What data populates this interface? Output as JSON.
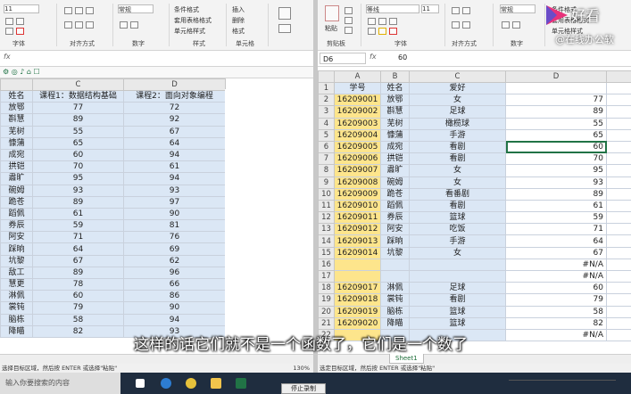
{
  "left": {
    "ribbon_groups": [
      "字体",
      "对齐方式",
      "数字",
      "样式",
      "单元格"
    ],
    "style_items": [
      "条件格式",
      "套用表格格式",
      "单元格样式"
    ],
    "cell_items": [
      "插入",
      "删除",
      "格式"
    ],
    "num_format": "常规",
    "font_size": "11",
    "columns": [
      "C",
      "D"
    ],
    "header_row": {
      "name": "姓名",
      "c": "课程1：数据结构基础",
      "d": "课程2：面向对象编程"
    },
    "rows": [
      [
        "放鄂",
        "77",
        "72"
      ],
      [
        "斟慧",
        "89",
        "92"
      ],
      [
        "芜树",
        "55",
        "67"
      ],
      [
        "慷蒲",
        "65",
        "64"
      ],
      [
        "成宛",
        "60",
        "94"
      ],
      [
        "拱铠",
        "70",
        "61"
      ],
      [
        "肅旷",
        "95",
        "94"
      ],
      [
        "碗姆",
        "93",
        "93"
      ],
      [
        "跪苍",
        "89",
        "97"
      ],
      [
        "蹈佩",
        "61",
        "90"
      ],
      [
        "券辰",
        "59",
        "81"
      ],
      [
        "阿安",
        "71",
        "76"
      ],
      [
        "踩晌",
        "64",
        "69"
      ],
      [
        "坑黎",
        "67",
        "62"
      ],
      [
        "敌工",
        "89",
        "96"
      ],
      [
        "慧更",
        "78",
        "66"
      ],
      [
        "淋佩",
        "60",
        "86"
      ],
      [
        "裳钝",
        "79",
        "90"
      ],
      [
        "脑栋",
        "58",
        "94"
      ],
      [
        "降瞄",
        "82",
        "93"
      ]
    ],
    "zoom": "130%",
    "status": "选择目标区域，然后按 ENTER 或选择\"粘贴\""
  },
  "right": {
    "ribbon_groups": [
      "剪贴板",
      "字体",
      "对齐方式",
      "数字"
    ],
    "paste_label": "粘贴",
    "font_name": "等线",
    "font_size": "11",
    "num_format": "常规",
    "style_items": [
      "条件格式",
      "套用表格格式",
      "单元格样式"
    ],
    "name_box": "D6",
    "formula_value": "60",
    "columns": [
      "A",
      "B",
      "C",
      "D"
    ],
    "header_row": {
      "a": "学号",
      "b": "姓名",
      "c": "爱好",
      "d": ""
    },
    "rows": [
      {
        "n": "2",
        "a": "16209001",
        "b": "放鄂",
        "c": "女",
        "d": "77"
      },
      {
        "n": "3",
        "a": "16209002",
        "b": "斟慧",
        "c": "足球",
        "d": "89"
      },
      {
        "n": "4",
        "a": "16209003",
        "b": "芜树",
        "c": "橄榄球",
        "d": "55"
      },
      {
        "n": "5",
        "a": "16209004",
        "b": "慷蒲",
        "c": "手游",
        "d": "65"
      },
      {
        "n": "6",
        "a": "16209005",
        "b": "成宛",
        "c": "看剧",
        "d": "60"
      },
      {
        "n": "7",
        "a": "16209006",
        "b": "拱铠",
        "c": "看剧",
        "d": "70"
      },
      {
        "n": "8",
        "a": "16209007",
        "b": "肅旷",
        "c": "女",
        "d": "95"
      },
      {
        "n": "9",
        "a": "16209008",
        "b": "碗姆",
        "c": "女",
        "d": "93"
      },
      {
        "n": "10",
        "a": "16209009",
        "b": "跪苍",
        "c": "看番剧",
        "d": "89"
      },
      {
        "n": "11",
        "a": "16209010",
        "b": "蹈佩",
        "c": "看剧",
        "d": "61"
      },
      {
        "n": "12",
        "a": "16209011",
        "b": "券辰",
        "c": "篮球",
        "d": "59"
      },
      {
        "n": "13",
        "a": "16209012",
        "b": "阿安",
        "c": "吃饭",
        "d": "71"
      },
      {
        "n": "14",
        "a": "16209013",
        "b": "踩晌",
        "c": "手游",
        "d": "64"
      },
      {
        "n": "15",
        "a": "16209014",
        "b": "坑黎",
        "c": "女",
        "d": "67"
      },
      {
        "n": "16",
        "a": "",
        "b": "",
        "c": "",
        "d": "#N/A"
      },
      {
        "n": "17",
        "a": "",
        "b": "",
        "c": "",
        "d": "#N/A"
      },
      {
        "n": "18",
        "a": "16209017",
        "b": "淋佩",
        "c": "足球",
        "d": "60"
      },
      {
        "n": "19",
        "a": "16209018",
        "b": "裳钝",
        "c": "看剧",
        "d": "79"
      },
      {
        "n": "20",
        "a": "16209019",
        "b": "脑栋",
        "c": "篮球",
        "d": "58"
      },
      {
        "n": "21",
        "a": "16209020",
        "b": "降瞄",
        "c": "篮球",
        "d": "82"
      },
      {
        "n": "22",
        "a": "",
        "b": "",
        "c": "",
        "d": "#N/A"
      }
    ],
    "sheet_tab": "Sheet1",
    "status": "选定目标区域，然后按 ENTER 或选择\"粘贴\""
  },
  "taskbar": {
    "search_placeholder": "输入你要搜索的内容",
    "record_button": "停止录制"
  },
  "caption": "这样的话它们就不是一个函数了，它们是一个数了",
  "watermark": {
    "brand": "好看",
    "channel": "@在线办公软"
  },
  "colors": {
    "header_band": "#dbe7f5",
    "id_fill": "#fde58c",
    "excel_green": "#217346"
  }
}
